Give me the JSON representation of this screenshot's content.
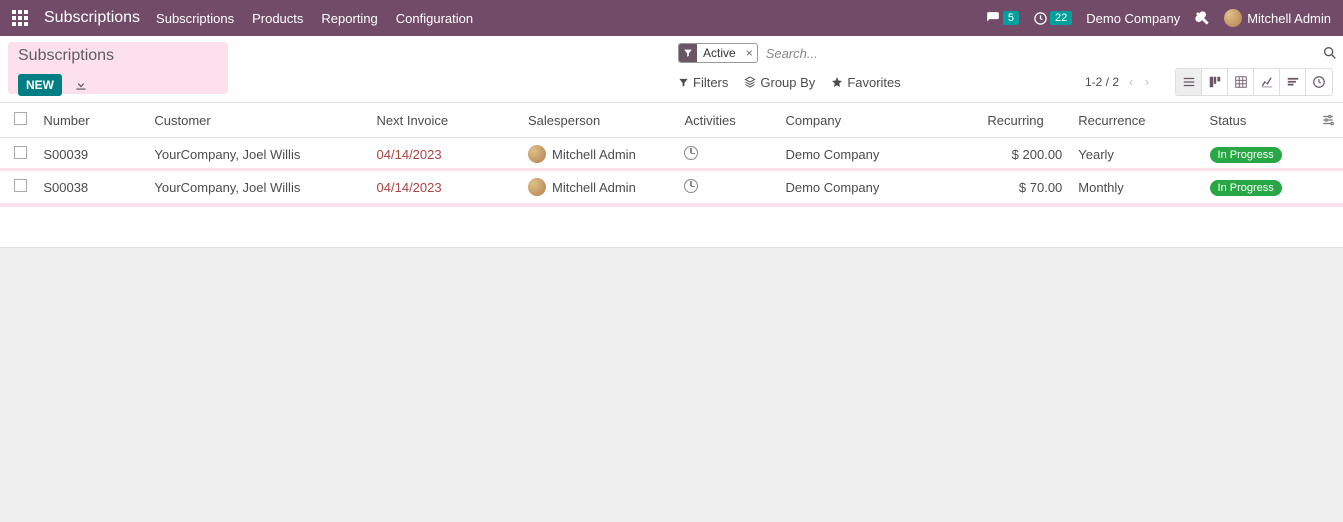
{
  "topnav": {
    "brand": "Subscriptions",
    "items": [
      "Subscriptions",
      "Products",
      "Reporting",
      "Configuration"
    ],
    "messages_badge": "5",
    "activities_badge": "22",
    "company": "Demo Company",
    "user": "Mitchell Admin"
  },
  "header": {
    "title": "Subscriptions",
    "new_label": "NEW"
  },
  "search": {
    "active_chip": "Active",
    "placeholder": "Search..."
  },
  "toolbar": {
    "filters": "Filters",
    "group_by": "Group By",
    "favorites": "Favorites",
    "pager": "1-2 / 2"
  },
  "columns": {
    "number": "Number",
    "customer": "Customer",
    "next_invoice": "Next Invoice",
    "salesperson": "Salesperson",
    "activities": "Activities",
    "company": "Company",
    "recurring": "Recurring",
    "recurrence": "Recurrence",
    "status": "Status"
  },
  "rows": [
    {
      "number": "S00039",
      "customer": "YourCompany, Joel Willis",
      "next_invoice": "04/14/2023",
      "salesperson": "Mitchell Admin",
      "company": "Demo Company",
      "recurring": "$ 200.00",
      "recurrence": "Yearly",
      "status": "In Progress"
    },
    {
      "number": "S00038",
      "customer": "YourCompany, Joel Willis",
      "next_invoice": "04/14/2023",
      "salesperson": "Mitchell Admin",
      "company": "Demo Company",
      "recurring": "$ 70.00",
      "recurrence": "Monthly",
      "status": "In Progress"
    }
  ]
}
